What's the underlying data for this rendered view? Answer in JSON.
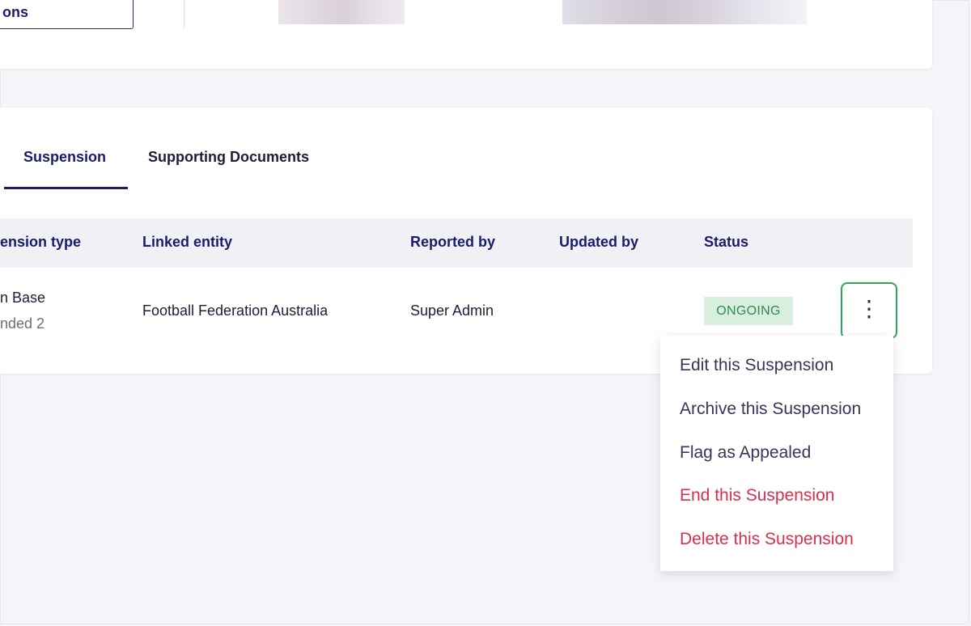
{
  "top_card": {
    "partial_button_label": "ons"
  },
  "tabs": [
    {
      "label": "Suspension",
      "active": true
    },
    {
      "label": "Supporting Documents",
      "active": false
    }
  ],
  "table": {
    "columns": [
      "ension type",
      "Linked entity",
      "Reported by",
      "Updated by",
      "Status"
    ],
    "rows": [
      {
        "type_line1": "n Base",
        "type_line2": "nded 2",
        "linked_entity": "Football Federation Australia",
        "reported_by": "Super Admin",
        "updated_by": "",
        "status": "ONGOING"
      }
    ]
  },
  "row_actions": {
    "kebab_icon": "more-vertical-icon",
    "kebab_glyph": "⋮"
  },
  "menu": {
    "items": [
      {
        "label": "Edit this Suspension",
        "danger": false
      },
      {
        "label": "Archive this Suspension",
        "danger": false
      },
      {
        "label": "Flag as Appealed",
        "danger": false
      },
      {
        "label": "End this Suspension",
        "danger": true
      },
      {
        "label": "Delete this Suspension",
        "danger": true
      }
    ]
  },
  "colors": {
    "brand_navy": "#1a1b6b",
    "status_green_bg": "#d9efe0",
    "status_green_text": "#2e8a4e",
    "highlight_green": "#30a55a",
    "danger_red": "#d4304e"
  }
}
